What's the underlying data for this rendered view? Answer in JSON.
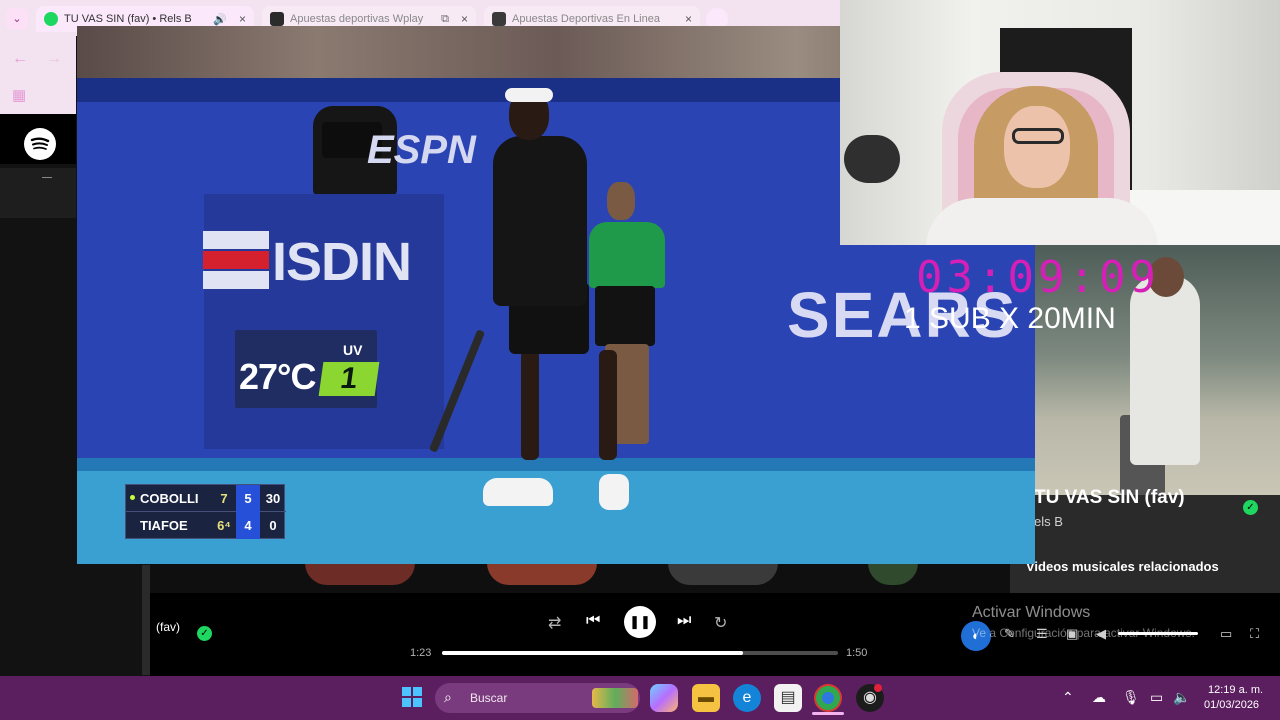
{
  "browser": {
    "tabs": [
      {
        "title": "TU VAS SIN (fav) • Rels B",
        "icon": "spotify-icon",
        "audio_icon": "speaker-icon",
        "color": "#1ed760"
      },
      {
        "title": "Apuestas deportivas Wplay",
        "icon": "wplay-icon",
        "extra_icon": "picture-in-picture-icon",
        "color": "#2b2b2b"
      },
      {
        "title": "Apuestas Deportivas En Linea",
        "icon": "rushbet-icon",
        "color": "#3a3a3a"
      }
    ],
    "close_glyph": "×"
  },
  "stream_overlay": {
    "timer": "03:09:09",
    "rule": "1 SUB X 20MIN",
    "timer_color": "#d51fb6"
  },
  "video": {
    "sponsor_isdin": "ISDIN",
    "sponsor_espn": "ESPN",
    "sponsor_sears": "SEARS",
    "temperature": "27°C",
    "uv_label": "UV",
    "uv_value": "1",
    "scoreboard": [
      {
        "name": "COBOLLI",
        "set1": "7",
        "set2": "5",
        "points": "30",
        "serving": true
      },
      {
        "name": "TIAFOE",
        "set1": "6⁴",
        "set2": "4",
        "points": "0",
        "serving": false
      }
    ]
  },
  "spotify": {
    "now_playing": {
      "title": "TU VAS SIN (fav)",
      "artist": "els B",
      "related_heading": "Videos musicales relacionados",
      "bar_title": "(fav)"
    },
    "playback": {
      "current_time": "1:23",
      "total_time": "1:50",
      "progress_fraction": 0.76
    }
  },
  "windows": {
    "activate_title": "Activar Windows",
    "activate_sub": "Ve a Configuración para activar Windows.",
    "search_placeholder": "Buscar",
    "clock_time": "12:19 a. m.",
    "clock_date": "01/03/2026"
  }
}
